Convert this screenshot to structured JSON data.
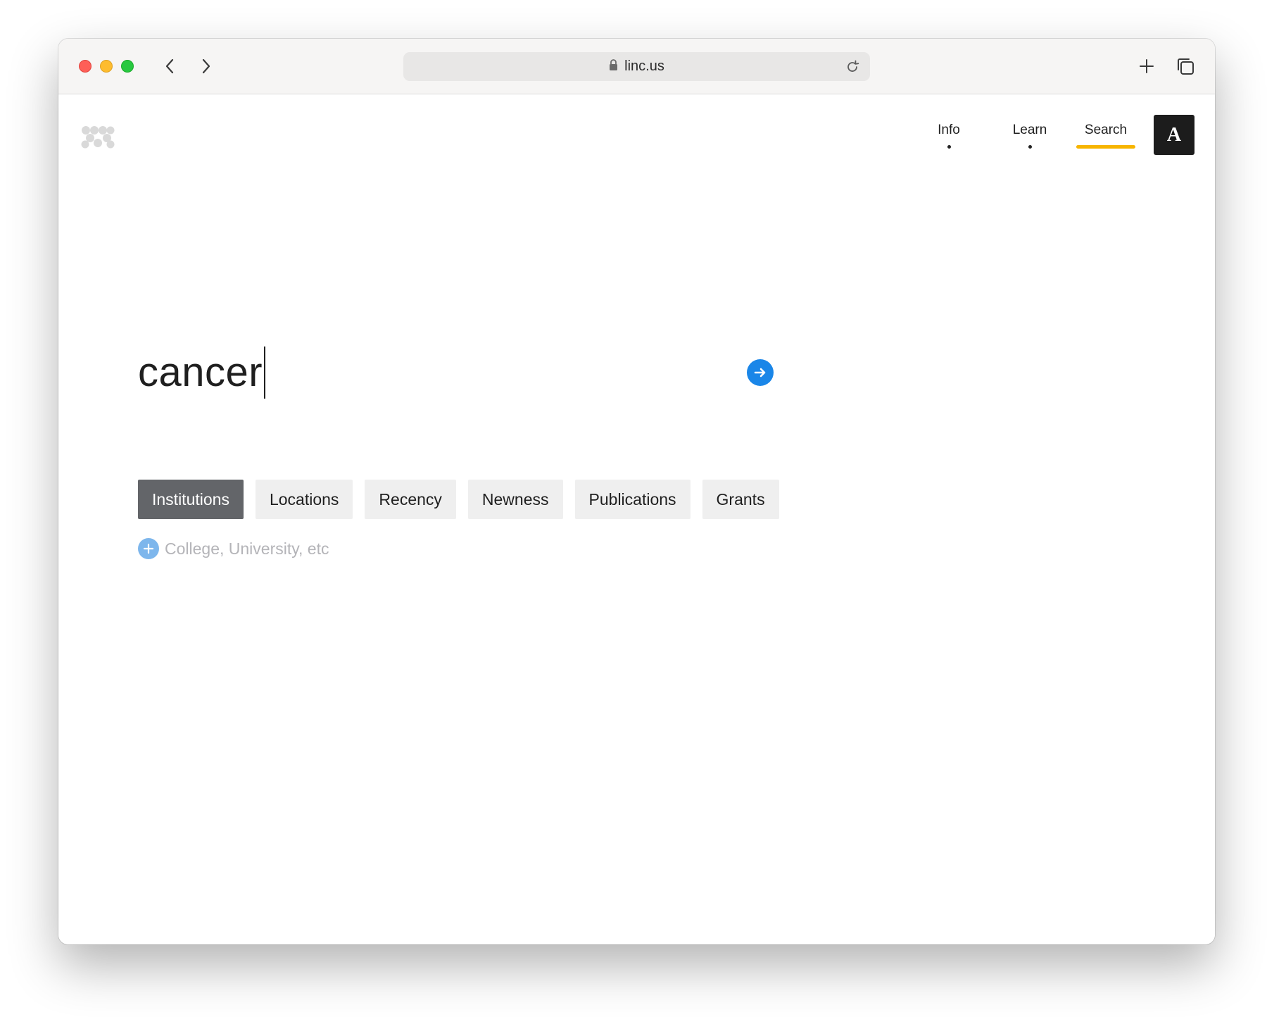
{
  "browser": {
    "url": "linc.us",
    "traffic_lights": [
      "close",
      "minimize",
      "maximize"
    ],
    "icons": {
      "back": "chevron-left-icon",
      "forward": "chevron-right-icon",
      "lock": "lock-icon",
      "reload": "reload-icon",
      "new_tab": "plus-icon",
      "tabs_overview": "tabs-icon"
    }
  },
  "header": {
    "logo": "linc-logo",
    "nav": [
      {
        "label": "Info",
        "indicator": "dot"
      },
      {
        "label": "Learn",
        "indicator": "dot"
      },
      {
        "label": "Search",
        "indicator": "underline",
        "active": true
      }
    ],
    "account_label": "A",
    "accent_color": "#f7b500"
  },
  "search": {
    "query": "cancer",
    "submit_icon": "arrow-right-icon",
    "submit_color": "#1a86e8"
  },
  "filters": {
    "tabs": [
      "Institutions",
      "Locations",
      "Recency",
      "Newness",
      "Publications",
      "Grants"
    ],
    "active_index": 0,
    "add_icon": "plus-circle-icon",
    "add_placeholder": "College, University, etc"
  }
}
